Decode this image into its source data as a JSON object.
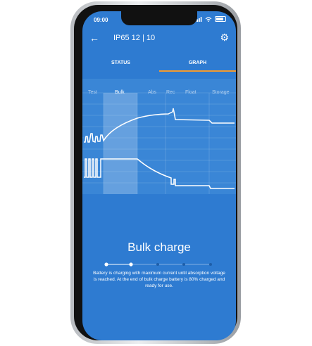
{
  "status_bar": {
    "time": "09:00"
  },
  "header": {
    "back": "←",
    "title": "IP65 12 | 10",
    "settings": "⚙"
  },
  "tabs": [
    {
      "label": "STATUS"
    },
    {
      "label": "GRAPH"
    }
  ],
  "graph": {
    "phases": [
      "Test",
      "Bulk",
      "Abs",
      "Rec",
      "Float",
      "Storage"
    ],
    "active_phase": "Bulk"
  },
  "headline": "Bulk charge",
  "description": "Battery is charging with maximum current until absorption voltage is reached. At the end of bulk charge battery is 80% charged and ready for use.",
  "progress": {
    "steps": 5,
    "current_step": 2
  },
  "colors": {
    "background": "#2e7bd1",
    "tab_indicator": "#f29b30",
    "chart_line": "#ffffff"
  }
}
